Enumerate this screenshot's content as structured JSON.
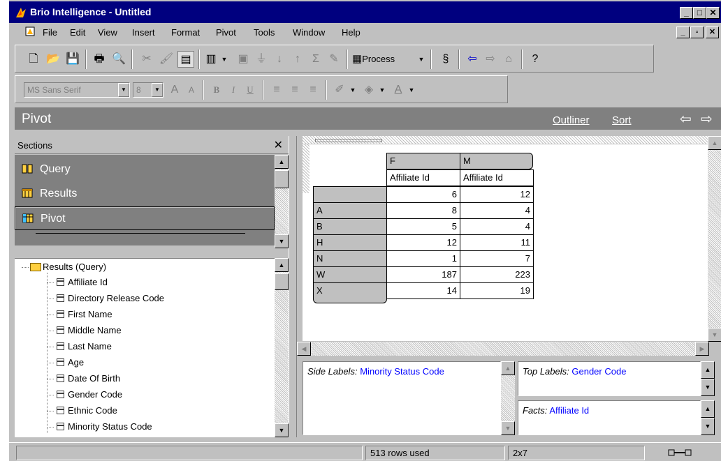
{
  "window": {
    "title": "Brio Intelligence - Untitled"
  },
  "menu": [
    "File",
    "Edit",
    "View",
    "Insert",
    "Format",
    "Pivot",
    "Tools",
    "Window",
    "Help"
  ],
  "toolbar": {
    "process_label": "Process"
  },
  "format_toolbar": {
    "font_name": "MS Sans Serif",
    "font_size": "8"
  },
  "section_bar": {
    "title": "Pivot",
    "outliner_label": "Outliner",
    "sort_label": "Sort"
  },
  "sections_panel": {
    "header": "Sections",
    "items": [
      {
        "label": "Query",
        "icon": "query-icon"
      },
      {
        "label": "Results",
        "icon": "results-icon"
      },
      {
        "label": "Pivot",
        "icon": "pivot-icon",
        "selected": true
      }
    ]
  },
  "tree": {
    "root": "Results (Query)",
    "items": [
      "Affiliate Id",
      "Directory Release Code",
      "First Name",
      "Middle Name",
      "Last Name",
      "Age",
      "Date Of Birth",
      "Gender Code",
      "Ethnic Code",
      "Minority Status Code"
    ]
  },
  "pivot": {
    "top_headers": [
      "F",
      "M"
    ],
    "fact_headers": [
      "Affiliate Id",
      "Affiliate Id"
    ],
    "rows": [
      {
        "label": "",
        "values": [
          "6",
          "12"
        ]
      },
      {
        "label": "A",
        "values": [
          "8",
          "4"
        ]
      },
      {
        "label": "B",
        "values": [
          "5",
          "4"
        ]
      },
      {
        "label": "H",
        "values": [
          "12",
          "11"
        ]
      },
      {
        "label": "N",
        "values": [
          "1",
          "7"
        ]
      },
      {
        "label": "W",
        "values": [
          "187",
          "223"
        ]
      },
      {
        "label": "X",
        "values": [
          "14",
          "19"
        ]
      }
    ]
  },
  "labels": {
    "side_prefix": "Side Labels:",
    "side_value": "Minority Status Code",
    "top_prefix": "Top Labels:",
    "top_value": "Gender Code",
    "facts_prefix": "Facts:",
    "facts_value": "Affiliate Id"
  },
  "status": {
    "rows_used": "513 rows used",
    "dimensions": "2x7"
  },
  "colors": {
    "title_bar": "#00007f",
    "section_bar": "#808080",
    "label_value": "#0000ff"
  }
}
